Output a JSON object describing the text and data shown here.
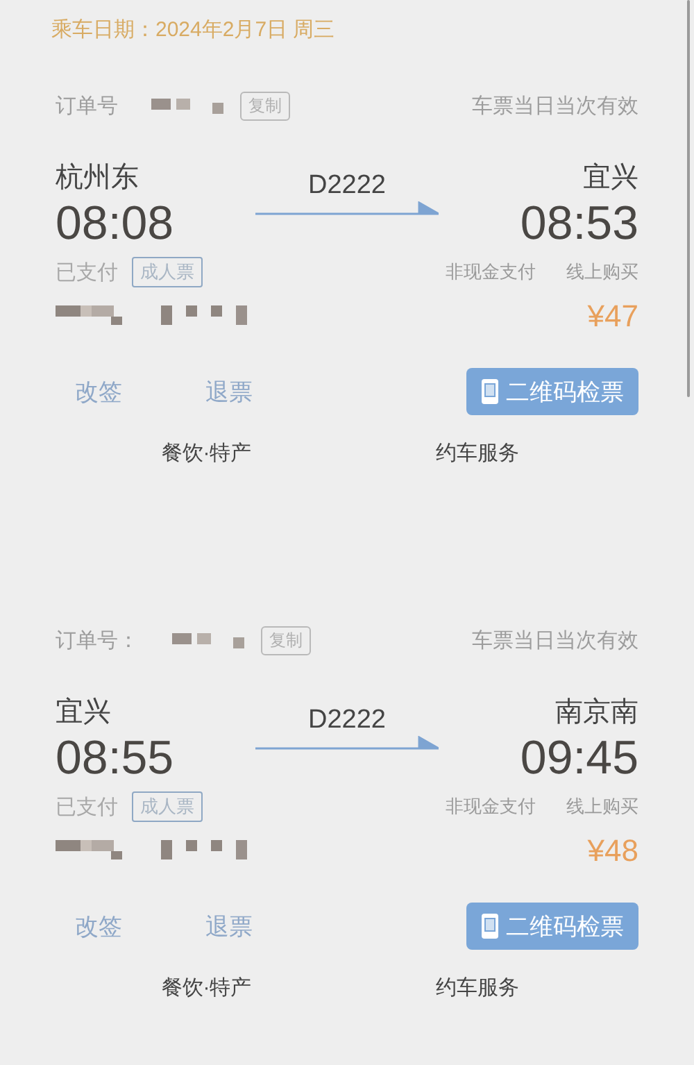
{
  "travel_date": {
    "label": "乘车日期：",
    "value": "2024年2月7日 周三"
  },
  "tickets": [
    {
      "order_label": "订单号",
      "copy_button": "复制",
      "validity": "车票当日当次有效",
      "from_station": "杭州东",
      "departure_time": "08:08",
      "train_number": "D2222",
      "to_station": "宜兴",
      "arrival_time": "08:53",
      "payment_status": "已支付",
      "ticket_type": "成人票",
      "payment_method": "非现金支付",
      "purchase_channel": "线上购买",
      "price": "¥47",
      "change_button": "改签",
      "refund_button": "退票",
      "qr_button": "二维码检票",
      "services": [
        "餐饮·特产",
        "约车服务"
      ]
    },
    {
      "order_label": "订单号：",
      "copy_button": "复制",
      "validity": "车票当日当次有效",
      "from_station": "宜兴",
      "departure_time": "08:55",
      "train_number": "D2222",
      "to_station": "南京南",
      "arrival_time": "09:45",
      "payment_status": "已支付",
      "ticket_type": "成人票",
      "payment_method": "非现金支付",
      "purchase_channel": "线上购买",
      "price": "¥48",
      "change_button": "改签",
      "refund_button": "退票",
      "qr_button": "二维码检票",
      "services": [
        "餐饮·特产",
        "约车服务"
      ]
    }
  ]
}
